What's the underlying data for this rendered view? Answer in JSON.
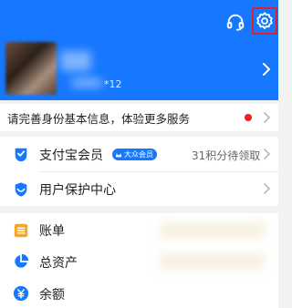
{
  "header": {
    "customer_service_icon": "headset-icon",
    "settings_icon": "gear-icon",
    "highlight_color": "#e0202a",
    "bg_color": "#1677ff",
    "user_suffix": "*12"
  },
  "notice": {
    "text": "请完善身份基本信息，体验更多服务",
    "dot_color": "#e8231d"
  },
  "card1": {
    "items": [
      {
        "label": "支付宝会员",
        "icon": "member-check-icon",
        "badge": "大众会员",
        "badge_icon": "crown-icon",
        "extra": "31积分待领取"
      },
      {
        "label": "用户保护中心",
        "icon": "shield-icon"
      }
    ]
  },
  "card2": {
    "items": [
      {
        "label": "账单",
        "icon": "bill-icon"
      },
      {
        "label": "总资产",
        "icon": "pie-chart-icon"
      },
      {
        "label": "余额",
        "icon": "yuan-icon"
      }
    ]
  }
}
